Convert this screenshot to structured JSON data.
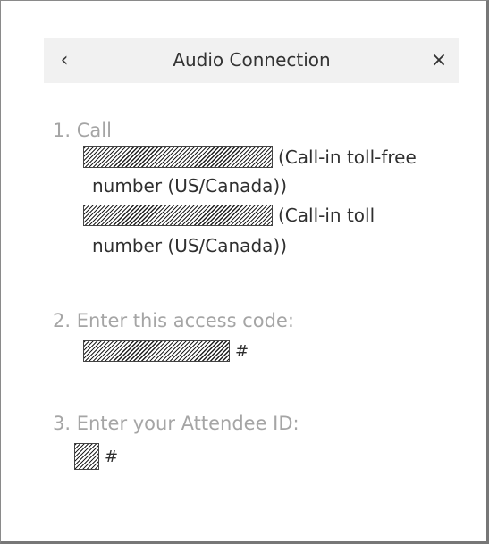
{
  "dialog": {
    "title": "Audio Connection",
    "back_glyph": "‹",
    "close_glyph": "×",
    "icons": {
      "back": "chevron-left-icon",
      "close": "close-icon"
    }
  },
  "steps": [
    {
      "heading": "1. Call",
      "tollfree_suffix": "(Call-in toll-free",
      "tollfree_cont": "number (US/Canada))",
      "toll_suffix": "(Call-in toll",
      "toll_cont": "number (US/Canada))"
    },
    {
      "heading": "2. Enter this access code:",
      "hash": "#"
    },
    {
      "heading": "3. Enter your Attendee ID:",
      "hash": "#"
    }
  ]
}
